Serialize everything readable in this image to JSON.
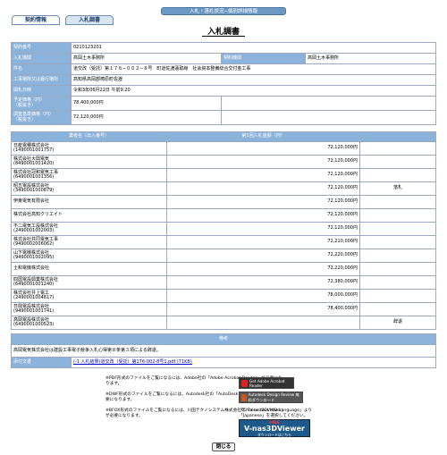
{
  "window": {
    "title": "入札・落札状況−個別詳細情報"
  },
  "tabs": [
    {
      "label": "契約情報"
    },
    {
      "label": "入札調書"
    }
  ],
  "page_title": "入札調書",
  "info": {
    "contract_no_label": "契約番号",
    "contract_no": "0210123201",
    "agency_label": "入札機関",
    "agency": "高岡土木事務所",
    "contract_agency_label": "契約機関",
    "contract_agency": "高岡土木事務所",
    "project_label": "件名",
    "project": "道交改（受託）第１７６−００２−８号　町道佐渡蓮取線　社会資本整備総合交付金工事",
    "location_label": "工事場所又は履行場所",
    "location": "高知県高岡郡梼原町佐渡",
    "date_label": "開札日時",
    "date": "令和3年06月22日 午前9:20",
    "planned_label": "予定価格（円）\n（税抜き）",
    "planned": "78,400,000円",
    "min_label": "調査基準価格（円）\n（税抜き）",
    "min": "72,120,000円"
  },
  "bids": {
    "col_name": "業者名（出入番号）",
    "col_amount": "第1回入札金額（円）",
    "rows": [
      {
        "name": "日産電種株式会社",
        "code": "(1490001001757)",
        "amount": "72,120,000円",
        "remark": ""
      },
      {
        "name": "株式会社大興電気",
        "code": "(8490001001420)",
        "amount": "72,120,000円",
        "remark": ""
      },
      {
        "name": "株式会社冠和電気工事",
        "code": "(6490001001356)",
        "amount": "72,120,000円",
        "remark": ""
      },
      {
        "name": "昭五電設株式会社",
        "code": "(3490001000879)",
        "amount": "72,120,000円",
        "remark": "落札"
      },
      {
        "name": "伊東電気有限会社",
        "code": "",
        "amount": "72,120,000円",
        "remark": ""
      },
      {
        "name": "株式会社高知クリエイト",
        "code": "",
        "amount": "72,120,000円",
        "remark": ""
      },
      {
        "name": "不二電気工設株式会社",
        "code": "(2490001002003)",
        "amount": "72,120,000円",
        "remark": ""
      },
      {
        "name": "株式会社共同電気工事",
        "code": "(9490002006062)",
        "amount": "72,210,000円",
        "remark": ""
      },
      {
        "name": "山下電機株式会社",
        "code": "(9490001002095)",
        "amount": "72,220,000円",
        "remark": ""
      },
      {
        "name": "土和電機株式会社",
        "code": "",
        "amount": "72,220,000円",
        "remark": ""
      },
      {
        "name": "四国電設興業株式会社",
        "code": "(6490001001240)",
        "amount": "72,380,000円",
        "remark": ""
      },
      {
        "name": "株式会社井上電工",
        "code": "(2490001004817)",
        "amount": "78,000,000円",
        "remark": ""
      },
      {
        "name": "日興電設株式会社",
        "code": "(9490001001741)",
        "amount": "78,400,000円",
        "remark": ""
      },
      {
        "name": "高岡電設株式会社",
        "code": "(6490001000523)",
        "amount": "",
        "remark": "辞退"
      }
    ]
  },
  "remark": {
    "header": "備考",
    "text": "高岡電気株式会社は建設工事電子競争入札心得第８条第３項による辞退。",
    "attach_label": "添付文書",
    "attach_link": "(-1 入札結果)道交改（受託）第176-002-8号1.pdf (71KB)"
  },
  "notes": {
    "pdf": "※PDF形式のファイルをご覧になるには、Adobe社の「Adobe Acrobat Reader」が必要になります。",
    "dwf": "※DWF形式のファイルをご覧になるには、Autodesk社の「AutoDesk Design Review」が必要になります。",
    "choose": "「Choose Your MSI Language」より「Japanese」を選択してください。",
    "sfx": "※BFOX形式のファイルをご覧になるには、川田テクノシステム株式会社の「V-nas3DViewer」が必要になります。"
  },
  "banners": {
    "acrobat": "Get Adobe Acrobat Reader",
    "autodesk": "Autodesk Design Review 無料ダウンロード",
    "vnas_top": "FREE",
    "vnas": "V-nas3DViewer",
    "vnas_sub": "ダウンロードはこちら"
  },
  "close_label": "閉じる",
  "colors": {
    "header": "#8bb2db",
    "topbar": "#6c98c4"
  }
}
